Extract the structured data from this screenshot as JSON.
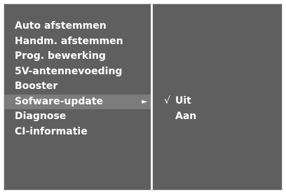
{
  "menu": {
    "items": [
      {
        "label": "Auto afstemmen"
      },
      {
        "label": "Handm. afstemmen"
      },
      {
        "label": "Prog. bewerking"
      },
      {
        "label": "5V-antennevoeding"
      },
      {
        "label": "Booster"
      },
      {
        "label": "Sofware-update",
        "arrow": "►"
      },
      {
        "label": "Diagnose"
      },
      {
        "label": "CI-informatie"
      }
    ]
  },
  "submenu": {
    "check_mark": "√",
    "options": [
      {
        "label": "Uit",
        "selected": true
      },
      {
        "label": "Aan",
        "selected": false
      }
    ]
  },
  "colors": {
    "panel_background": "#5f5f5f",
    "highlight": "#7c7c7c",
    "divider": "#f4f4f4",
    "text": "#ffffff"
  },
  "icons": {
    "submenu_arrow": "right-arrow-icon",
    "selection_mark": "check-icon"
  }
}
